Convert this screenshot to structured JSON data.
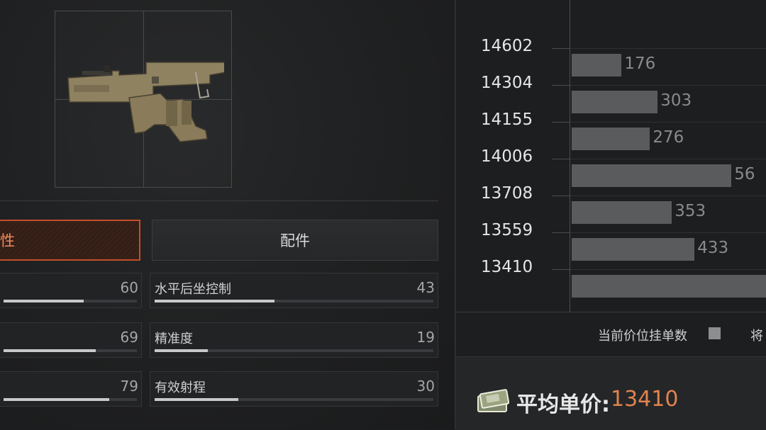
{
  "tabs": {
    "attributes_label": "性",
    "parts_label": "配件"
  },
  "stats": [
    {
      "label": "",
      "value": "60",
      "fraction": 0.6
    },
    {
      "label": "水平后坐控制",
      "value": "43",
      "fraction": 0.43
    },
    {
      "label": "",
      "value": "69",
      "fraction": 0.69
    },
    {
      "label": "精准度",
      "value": "19",
      "fraction": 0.19
    },
    {
      "label": "",
      "value": "79",
      "fraction": 0.79
    },
    {
      "label": "有效射程",
      "value": "30",
      "fraction": 0.3
    }
  ],
  "chart_data": {
    "type": "bar",
    "orientation": "horizontal",
    "price_levels": [
      "14602",
      "14304",
      "14155",
      "14006",
      "13708",
      "13559",
      "13410"
    ],
    "series": [
      {
        "name": "当前价位挂单数",
        "values": [
          176,
          303,
          276,
          563,
          353,
          433,
          null
        ],
        "labels": [
          "176",
          "303",
          "276",
          "56",
          "353",
          "433",
          ""
        ]
      }
    ],
    "bar_color": "#5a5b5d"
  },
  "legend": {
    "current_label": "当前价位挂单数",
    "next_label": "将"
  },
  "avg_price": {
    "label": "平均单价:",
    "value": "13410",
    "value_color": "#e0834e"
  }
}
